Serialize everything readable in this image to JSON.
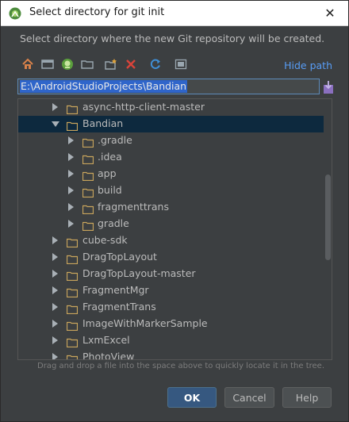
{
  "window": {
    "title": "Select directory for git init",
    "close_symbol": "✕"
  },
  "description": "Select directory where the new Git repository will be created.",
  "toolbar": {
    "icons": [
      "home-icon",
      "desktop-icon",
      "android-project-icon",
      "folder-icon",
      "new-folder-icon",
      "delete-icon",
      "refresh-icon",
      "show-hidden-icon"
    ],
    "hide_path_label": "Hide path"
  },
  "path": {
    "value": "E:\\AndroidStudioProjects\\Bandian"
  },
  "tree": {
    "rows": [
      {
        "label": "async-http-client-master",
        "level": 0,
        "expanded": false,
        "selected": false
      },
      {
        "label": "Bandian",
        "level": 0,
        "expanded": true,
        "selected": true
      },
      {
        "label": ".gradle",
        "level": 1,
        "expanded": false,
        "selected": false
      },
      {
        "label": ".idea",
        "level": 1,
        "expanded": false,
        "selected": false
      },
      {
        "label": "app",
        "level": 1,
        "expanded": false,
        "selected": false
      },
      {
        "label": "build",
        "level": 1,
        "expanded": false,
        "selected": false
      },
      {
        "label": "fragmenttrans",
        "level": 1,
        "expanded": false,
        "selected": false
      },
      {
        "label": "gradle",
        "level": 1,
        "expanded": false,
        "selected": false
      },
      {
        "label": "cube-sdk",
        "level": 0,
        "expanded": false,
        "selected": false
      },
      {
        "label": "DragTopLayout",
        "level": 0,
        "expanded": false,
        "selected": false
      },
      {
        "label": "DragTopLayout-master",
        "level": 0,
        "expanded": false,
        "selected": false
      },
      {
        "label": "FragmentMgr",
        "level": 0,
        "expanded": false,
        "selected": false
      },
      {
        "label": "FragmentTrans",
        "level": 0,
        "expanded": false,
        "selected": false
      },
      {
        "label": "ImageWithMarkerSample",
        "level": 0,
        "expanded": false,
        "selected": false
      },
      {
        "label": "LxmExcel",
        "level": 0,
        "expanded": false,
        "selected": false
      },
      {
        "label": "PhotoView",
        "level": 0,
        "expanded": false,
        "selected": false
      }
    ]
  },
  "hint": "Drag and drop a file into the space above to quickly locate it in the tree.",
  "buttons": {
    "ok": "OK",
    "cancel": "Cancel",
    "help": "Help"
  },
  "colors": {
    "accent": "#589df6",
    "selection": "#0d293e",
    "folder": "#c9a55c",
    "ok_button": "#365880"
  }
}
